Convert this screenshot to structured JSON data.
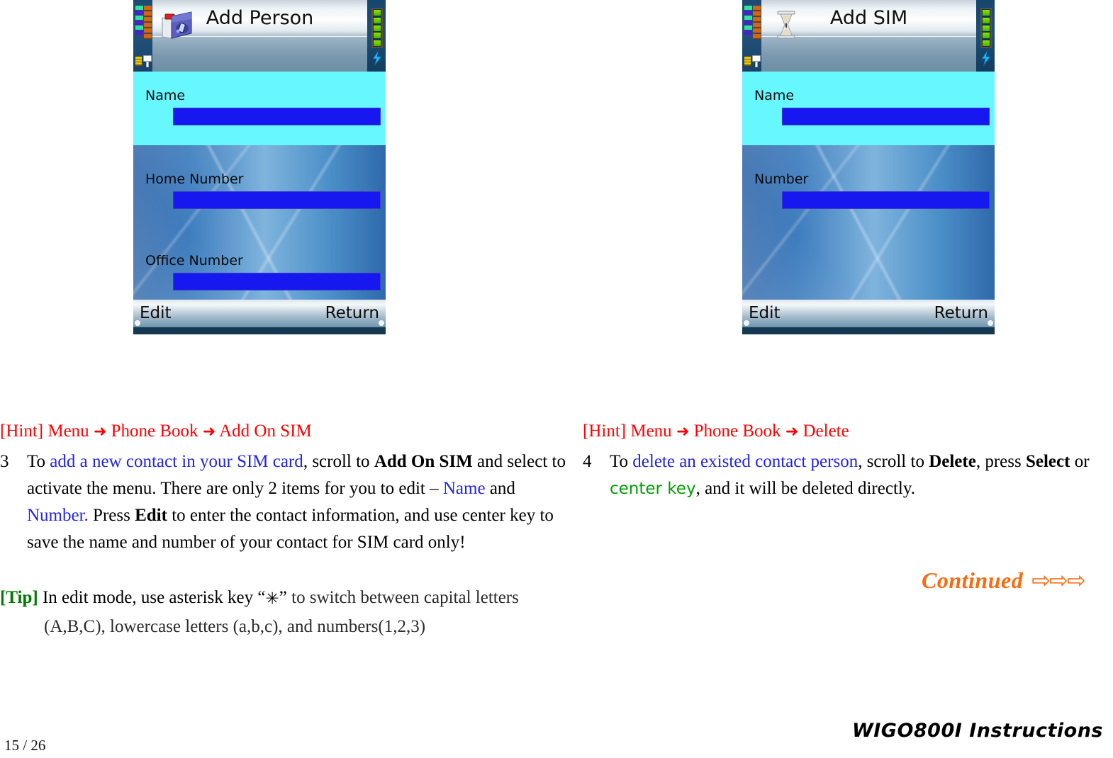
{
  "screens": [
    {
      "id": "add-person",
      "title": "Add Person",
      "icon": "contacts-folder-icon",
      "fields": [
        {
          "label": "Name",
          "selected": true
        },
        {
          "label": "Home Number",
          "selected": false
        },
        {
          "label": "Office Number",
          "selected": false
        }
      ],
      "softkeys": {
        "left": "Edit",
        "right": "Return"
      }
    },
    {
      "id": "add-sim",
      "title": "Add SIM",
      "icon": "hourglass-icon",
      "fields": [
        {
          "label": "Name",
          "selected": true
        },
        {
          "label": "Number",
          "selected": false
        }
      ],
      "softkeys": {
        "left": "Edit",
        "right": "Return"
      }
    }
  ],
  "left_column": {
    "hint": {
      "prefix": "[Hint] Menu",
      "step1": "Phone Book",
      "step2": "Add On SIM",
      "arrow": "➜"
    },
    "item": {
      "number": "3",
      "t1": "To ",
      "t2_blue": "add a new contact in your SIM card",
      "t3": ", scroll to ",
      "t4_bold": "Add On SIM",
      "t5": " and select to activate the menu. There are only 2 items for you to edit – ",
      "t6_blue": "Name",
      "t7": " and ",
      "t8_blue": "Number.",
      "t9": " Press ",
      "t10_bold": "Edit",
      "t11": " to enter the contact information, and use center key to save the name and number of your contact for SIM card only!"
    }
  },
  "right_column": {
    "hint": {
      "prefix": "[Hint] Menu",
      "step1": "Phone Book",
      "step2": "Delete",
      "arrow": "➜"
    },
    "item": {
      "number": "4",
      "t1": "To ",
      "t2_blue": "delete an existed contact person",
      "t3": ", scroll to ",
      "t4_bold": "Delete",
      "t5": ", press ",
      "t6_bold": "Select",
      "t7": " or ",
      "t8_green": "center key",
      "t9": ", and it will be deleted directly."
    }
  },
  "tip": {
    "mark": "[Tip]",
    "line1a": " In edit mode, use asterisk key ",
    "quote_open": "“",
    "star": "✳",
    "quote_close": "”",
    "line1b": " to switch between capital letters",
    "line2": "(A,B,C), lowercase letters (a,b,c), and numbers(1,2,3)"
  },
  "continued": {
    "label": "Continued",
    "arrows": "⇨⇨⇨"
  },
  "footer": {
    "page": "15 / 26",
    "brand": "WIGO800I Instructions"
  },
  "colors": {
    "hint_red": "#fe0000",
    "link_blue": "#2424e8",
    "tip_green": "#007a00",
    "center_key_green": "#00a000",
    "continued_orange": "#f96a12",
    "screen_selected": "#66f7ff",
    "field_input_blue": "#1717f0"
  }
}
